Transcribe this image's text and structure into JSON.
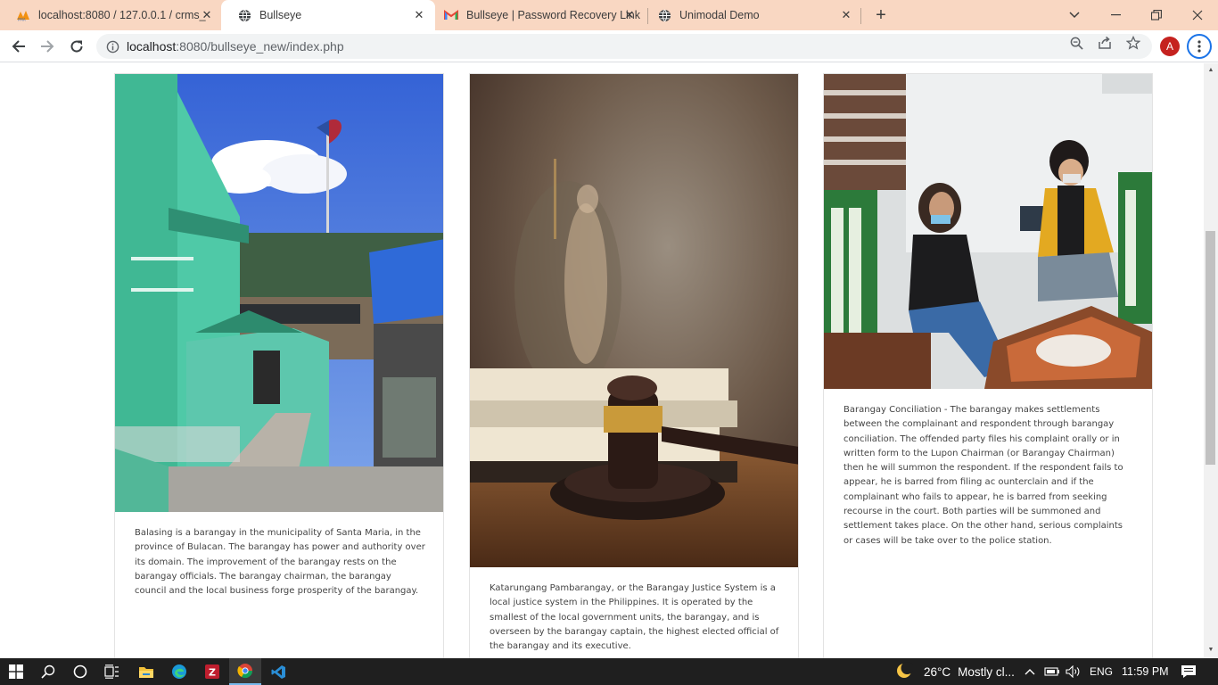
{
  "browser": {
    "tabs": [
      {
        "title": "localhost:8080 / 127.0.0.1 / crms_",
        "favicon": "phpmyadmin-icon",
        "active": false
      },
      {
        "title": "Bullseye",
        "favicon": "globe-icon",
        "active": true
      },
      {
        "title": "Bullseye | Password Recovery Link",
        "favicon": "gmail-icon",
        "active": false
      },
      {
        "title": "Unimodal Demo",
        "favicon": "globe-icon",
        "active": false
      }
    ],
    "url_host": "localhost",
    "url_rest": ":8080/bullseye_new/index.php",
    "profile_initial": "A",
    "accent_color": "#1a73e8",
    "tabbar_color": "#f9d7c2"
  },
  "cards": [
    {
      "image": "barangay hall with flag pole",
      "text": "Balasing is a barangay in the municipality of Santa Maria, in the province of Bulacan. The barangay has power and authority over its domain. The improvement of the barangay rests on the barangay officials. The barangay chairman, the barangay council and the local business forge prosperity of the barangay."
    },
    {
      "image": "lady justice statue and gavel",
      "text": "Katarungang Pambarangay, or the Barangay Justice System is a local justice system in the Philippines. It is operated by the smallest of the local government units, the barangay, and is overseen by the barangay captain, the highest elected official of the barangay and its executive."
    },
    {
      "image": "two people in conciliation meeting",
      "text": "Barangay Conciliation - The barangay makes settlements between the complainant and respondent through barangay conciliation. The offended party files his complaint orally or in written form to the Lupon Chairman (or Barangay Chairman) then he will summon the respondent. If the respondent fails to appear, he is barred from filing ac ounterclain and if the complainant who fails to appear, he is barred from seeking recourse in the court. Both parties will be summoned and settlement takes place. On the other hand, serious complaints or cases will be take over to the police station."
    }
  ],
  "taskbar": {
    "weather_temp": "26°C",
    "weather_desc": "Mostly cl...",
    "language": "ENG",
    "time": "11:59 PM"
  }
}
